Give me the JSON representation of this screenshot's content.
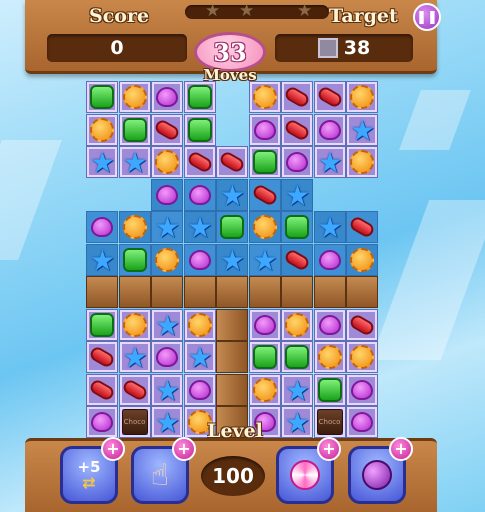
{
  "header": {
    "score_label": "Score",
    "score_value": "0",
    "target_label": "Target",
    "target_icon": "stone-block-icon",
    "target_value": "38",
    "moves_value": "33",
    "moves_label": "Moves",
    "progress_stars": 3,
    "progress_fraction": 0.0,
    "pause_icon": "pause-icon"
  },
  "footer": {
    "level_label": "Level",
    "level_value": "100",
    "boosters": [
      {
        "name": "extra-moves-booster",
        "label": "+5",
        "icon": "swap-arrows-icon"
      },
      {
        "name": "hand-booster",
        "icon": "pointing-hand-icon"
      },
      {
        "name": "lollipop-booster",
        "icon": "lollipop-icon"
      },
      {
        "name": "bomb-booster",
        "icon": "bomb-icon"
      }
    ],
    "plus_symbol": "+"
  },
  "board": {
    "columns": 9,
    "rows": 11,
    "chocolate_label": "Choco",
    "candy_types": [
      "green-square",
      "orange-flower",
      "purple-heart",
      "red-bean",
      "blue-star",
      "chocolate"
    ],
    "grid": [
      [
        "green-square",
        "orange-flower",
        "purple-heart",
        "green-square",
        "",
        "orange-flower",
        "red-bean",
        "red-bean",
        "orange-flower"
      ],
      [
        "orange-flower",
        "green-square",
        "red-bean",
        "green-square",
        "",
        "purple-heart",
        "red-bean",
        "purple-heart",
        "blue-star"
      ],
      [
        "blue-star",
        "blue-star",
        "orange-flower",
        "red-bean",
        "red-bean",
        "green-square",
        "purple-heart",
        "blue-star",
        "orange-flower"
      ],
      [
        "",
        "",
        "purple-heart",
        "purple-heart",
        "blue-star",
        "red-bean",
        "blue-star",
        "",
        ""
      ],
      [
        "purple-heart",
        "orange-flower",
        "blue-star",
        "blue-star",
        "green-square",
        "orange-flower",
        "green-square",
        "blue-star",
        "red-bean"
      ],
      [
        "blue-star",
        "green-square",
        "orange-flower",
        "purple-heart",
        "blue-star",
        "blue-star",
        "red-bean",
        "purple-heart",
        "orange-flower"
      ],
      [
        "wood",
        "wood",
        "wood",
        "wood",
        "wood",
        "wood",
        "wood",
        "wood",
        "wood"
      ],
      [
        "green-square",
        "orange-flower",
        "blue-star",
        "orange-flower",
        "",
        "purple-heart",
        "orange-flower",
        "purple-heart",
        "red-bean"
      ],
      [
        "red-bean",
        "blue-star",
        "purple-heart",
        "blue-star",
        "",
        "green-square",
        "green-square",
        "orange-flower",
        "orange-flower"
      ],
      [
        "red-bean",
        "red-bean",
        "blue-star",
        "purple-heart",
        "",
        "orange-flower",
        "blue-star",
        "green-square",
        "purple-heart"
      ],
      [
        "purple-heart",
        "chocolate",
        "blue-star",
        "orange-flower",
        "",
        "purple-heart",
        "blue-star",
        "chocolate",
        "purple-heart"
      ]
    ],
    "highlighted": [
      [
        0,
        0
      ],
      [
        0,
        1
      ],
      [
        0,
        2
      ],
      [
        0,
        3
      ],
      [
        0,
        5
      ],
      [
        0,
        6
      ],
      [
        0,
        7
      ],
      [
        0,
        8
      ],
      [
        1,
        0
      ],
      [
        1,
        1
      ],
      [
        1,
        2
      ],
      [
        1,
        3
      ],
      [
        1,
        5
      ],
      [
        1,
        6
      ],
      [
        1,
        7
      ],
      [
        1,
        8
      ],
      [
        2,
        0
      ],
      [
        2,
        1
      ],
      [
        2,
        2
      ],
      [
        2,
        3
      ],
      [
        2,
        4
      ],
      [
        2,
        5
      ],
      [
        2,
        6
      ],
      [
        2,
        7
      ],
      [
        2,
        8
      ],
      [
        7,
        0
      ],
      [
        7,
        1
      ],
      [
        7,
        2
      ],
      [
        7,
        3
      ],
      [
        7,
        5
      ],
      [
        7,
        6
      ],
      [
        7,
        7
      ],
      [
        7,
        8
      ],
      [
        8,
        0
      ],
      [
        8,
        1
      ],
      [
        8,
        2
      ],
      [
        8,
        3
      ],
      [
        8,
        5
      ],
      [
        8,
        6
      ],
      [
        8,
        7
      ],
      [
        8,
        8
      ],
      [
        9,
        0
      ],
      [
        9,
        1
      ],
      [
        9,
        2
      ],
      [
        9,
        3
      ],
      [
        9,
        5
      ],
      [
        9,
        6
      ],
      [
        9,
        7
      ],
      [
        9,
        8
      ],
      [
        10,
        0
      ],
      [
        10,
        1
      ],
      [
        10,
        2
      ],
      [
        10,
        3
      ],
      [
        10,
        5
      ],
      [
        10,
        6
      ],
      [
        10,
        7
      ],
      [
        10,
        8
      ]
    ]
  }
}
